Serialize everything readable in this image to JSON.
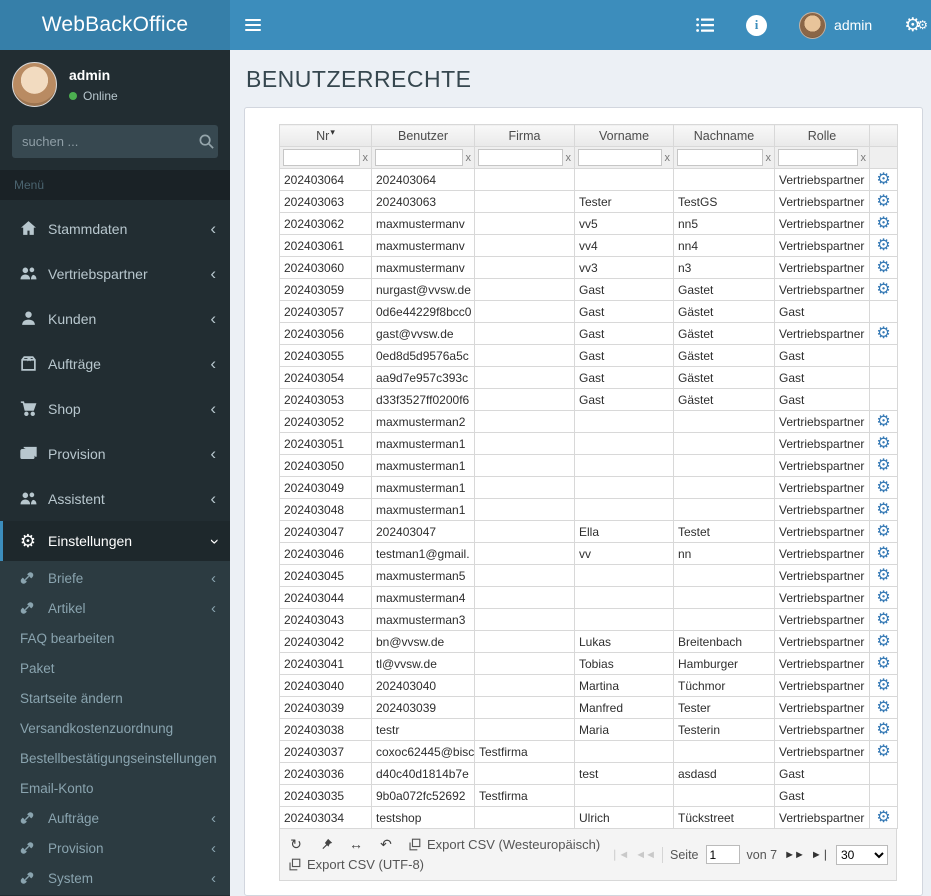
{
  "topbar": {
    "brand": "WebBackOffice",
    "user": "admin",
    "icons": [
      "hamburger-icon",
      "list-icon",
      "info-icon",
      "gears-icon"
    ]
  },
  "sidebar": {
    "user": {
      "name": "admin",
      "status": "Online"
    },
    "search_placeholder": "suchen ...",
    "menu_header": "Menü",
    "items": [
      {
        "label": "Stammdaten",
        "icon": "home",
        "chevron": true
      },
      {
        "label": "Vertriebspartner",
        "icon": "users",
        "chevron": true
      },
      {
        "label": "Kunden",
        "icon": "user",
        "chevron": true
      },
      {
        "label": "Aufträge",
        "icon": "package",
        "chevron": true
      },
      {
        "label": "Shop",
        "icon": "cart",
        "chevron": true
      },
      {
        "label": "Provision",
        "icon": "money",
        "chevron": true
      },
      {
        "label": "Assistent",
        "icon": "users",
        "chevron": true
      },
      {
        "label": "Einstellungen",
        "icon": "gear",
        "chevron": true,
        "active": true
      }
    ],
    "submenu": [
      {
        "label": "Briefe",
        "icon": "link",
        "chevron": true
      },
      {
        "label": "Artikel",
        "icon": "link",
        "chevron": true
      },
      {
        "label": "FAQ bearbeiten"
      },
      {
        "label": "Paket"
      },
      {
        "label": "Startseite ändern"
      },
      {
        "label": "Versandkostenzuordnung"
      },
      {
        "label": "Bestellbestätigungseinstellungen"
      },
      {
        "label": "Email-Konto"
      },
      {
        "label": "Aufträge",
        "icon": "link",
        "chevron": true
      },
      {
        "label": "Provision",
        "icon": "link",
        "chevron": true
      },
      {
        "label": "System",
        "icon": "link",
        "chevron": true
      }
    ]
  },
  "page": {
    "title": "BENUTZERRECHTE"
  },
  "table": {
    "columns": [
      "Nr",
      "Benutzer",
      "Firma",
      "Vorname",
      "Nachname",
      "Rolle",
      ""
    ],
    "sort_column_index": 0,
    "sort_arrow": "▾",
    "filter_clear": "x",
    "rows": [
      {
        "nr": "202403064",
        "benutzer": "202403064",
        "firma": "",
        "vorname": "",
        "nachname": "",
        "rolle": "Vertriebspartner",
        "gear": true
      },
      {
        "nr": "202403063",
        "benutzer": "202403063",
        "firma": "",
        "vorname": "Tester",
        "nachname": "TestGS",
        "rolle": "Vertriebspartner",
        "gear": true
      },
      {
        "nr": "202403062",
        "benutzer": "maxmustermanv",
        "firma": "",
        "vorname": "vv5",
        "nachname": "nn5",
        "rolle": "Vertriebspartner",
        "gear": true
      },
      {
        "nr": "202403061",
        "benutzer": "maxmustermanv",
        "firma": "",
        "vorname": "vv4",
        "nachname": "nn4",
        "rolle": "Vertriebspartner",
        "gear": true
      },
      {
        "nr": "202403060",
        "benutzer": "maxmustermanv",
        "firma": "",
        "vorname": "vv3",
        "nachname": "n3",
        "rolle": "Vertriebspartner",
        "gear": true
      },
      {
        "nr": "202403059",
        "benutzer": "nurgast@vvsw.de",
        "firma": "",
        "vorname": "Gast",
        "nachname": "Gastet",
        "rolle": "Vertriebspartner",
        "gear": true
      },
      {
        "nr": "202403057",
        "benutzer": "0d6e44229f8bcc0",
        "firma": "",
        "vorname": "Gast",
        "nachname": "Gästet",
        "rolle": "Gast",
        "gear": false
      },
      {
        "nr": "202403056",
        "benutzer": "gast@vvsw.de",
        "firma": "",
        "vorname": "Gast",
        "nachname": "Gästet",
        "rolle": "Vertriebspartner",
        "gear": true
      },
      {
        "nr": "202403055",
        "benutzer": "0ed8d5d9576a5c",
        "firma": "",
        "vorname": "Gast",
        "nachname": "Gästet",
        "rolle": "Gast",
        "gear": false
      },
      {
        "nr": "202403054",
        "benutzer": "aa9d7e957c393c",
        "firma": "",
        "vorname": "Gast",
        "nachname": "Gästet",
        "rolle": "Gast",
        "gear": false
      },
      {
        "nr": "202403053",
        "benutzer": "d33f3527ff0200f6",
        "firma": "",
        "vorname": "Gast",
        "nachname": "Gästet",
        "rolle": "Gast",
        "gear": false
      },
      {
        "nr": "202403052",
        "benutzer": "maxmusterman2",
        "firma": "",
        "vorname": "",
        "nachname": "",
        "rolle": "Vertriebspartner",
        "gear": true
      },
      {
        "nr": "202403051",
        "benutzer": "maxmusterman1",
        "firma": "",
        "vorname": "",
        "nachname": "",
        "rolle": "Vertriebspartner",
        "gear": true
      },
      {
        "nr": "202403050",
        "benutzer": "maxmusterman1",
        "firma": "",
        "vorname": "",
        "nachname": "",
        "rolle": "Vertriebspartner",
        "gear": true
      },
      {
        "nr": "202403049",
        "benutzer": "maxmusterman1",
        "firma": "",
        "vorname": "",
        "nachname": "",
        "rolle": "Vertriebspartner",
        "gear": true
      },
      {
        "nr": "202403048",
        "benutzer": "maxmusterman1",
        "firma": "",
        "vorname": "",
        "nachname": "",
        "rolle": "Vertriebspartner",
        "gear": true
      },
      {
        "nr": "202403047",
        "benutzer": "202403047",
        "firma": "",
        "vorname": "Ella",
        "nachname": "Testet",
        "rolle": "Vertriebspartner",
        "gear": true
      },
      {
        "nr": "202403046",
        "benutzer": "testman1@gmail.",
        "firma": "",
        "vorname": "vv",
        "nachname": "nn",
        "rolle": "Vertriebspartner",
        "gear": true
      },
      {
        "nr": "202403045",
        "benutzer": "maxmusterman5",
        "firma": "",
        "vorname": "",
        "nachname": "",
        "rolle": "Vertriebspartner",
        "gear": true
      },
      {
        "nr": "202403044",
        "benutzer": "maxmusterman4",
        "firma": "",
        "vorname": "",
        "nachname": "",
        "rolle": "Vertriebspartner",
        "gear": true
      },
      {
        "nr": "202403043",
        "benutzer": "maxmusterman3",
        "firma": "",
        "vorname": "",
        "nachname": "",
        "rolle": "Vertriebspartner",
        "gear": true
      },
      {
        "nr": "202403042",
        "benutzer": "bn@vvsw.de",
        "firma": "",
        "vorname": "Lukas",
        "nachname": "Breitenbach",
        "rolle": "Vertriebspartner",
        "gear": true
      },
      {
        "nr": "202403041",
        "benutzer": "tl@vvsw.de",
        "firma": "",
        "vorname": "Tobias",
        "nachname": "Hamburger",
        "rolle": "Vertriebspartner",
        "gear": true
      },
      {
        "nr": "202403040",
        "benutzer": "202403040",
        "firma": "",
        "vorname": "Martina",
        "nachname": "Tüchmor",
        "rolle": "Vertriebspartner",
        "gear": true
      },
      {
        "nr": "202403039",
        "benutzer": "202403039",
        "firma": "",
        "vorname": "Manfred",
        "nachname": "Tester",
        "rolle": "Vertriebspartner",
        "gear": true
      },
      {
        "nr": "202403038",
        "benutzer": "testr",
        "firma": "",
        "vorname": "Maria",
        "nachname": "Testerin",
        "rolle": "Vertriebspartner",
        "gear": true
      },
      {
        "nr": "202403037",
        "benutzer": "coxoc62445@bisc",
        "firma": "Testfirma",
        "vorname": "",
        "nachname": "",
        "rolle": "Vertriebspartner",
        "gear": true
      },
      {
        "nr": "202403036",
        "benutzer": "d40c40d1814b7e",
        "firma": "",
        "vorname": "test",
        "nachname": "asdasd",
        "rolle": "Gast",
        "gear": false
      },
      {
        "nr": "202403035",
        "benutzer": "9b0a072fc52692",
        "firma": "Testfirma",
        "vorname": "",
        "nachname": "",
        "rolle": "Gast",
        "gear": false
      },
      {
        "nr": "202403034",
        "benutzer": "testshop",
        "firma": "",
        "vorname": "Ulrich",
        "nachname": "Tückstreet",
        "rolle": "Vertriebspartner",
        "gear": true
      }
    ]
  },
  "pager": {
    "export_west": "Export CSV (Westeuropäisch)",
    "export_utf8": "Export CSV (UTF-8)",
    "seite_label": "Seite",
    "page_value": "1",
    "of_label": "von 7",
    "page_size": "30"
  },
  "colors": {
    "navbar": "#3c8dbc",
    "logo": "#367fa9",
    "sidebar": "#222d32",
    "submenu": "#2c3b41",
    "active_border": "#3c8dbc",
    "gear_blue": "#3579b5",
    "online_green": "#4caf50"
  }
}
